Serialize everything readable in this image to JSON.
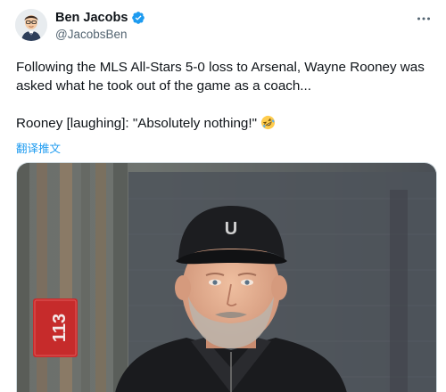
{
  "author": {
    "display_name": "Ben Jacobs",
    "handle": "@JacobsBen",
    "verified": true
  },
  "tweet": {
    "paragraph_1": "Following the MLS All-Stars 5-0 loss to Arsenal, Wayne Rooney was asked what he took out of the game as a coach...",
    "paragraph_2": "Rooney [laughing]: \"Absolutely nothing!\"",
    "emoji": "rolling-on-floor-laughing-emoji",
    "translate_label": "翻译推文"
  },
  "media": {
    "cap_logo_text": "U",
    "sign_text": "113"
  },
  "colors": {
    "link_blue": "#1d9bf0",
    "verified_blue": "#1d9bf0",
    "secondary_text": "#536471",
    "sign_red": "#c62b2b"
  },
  "icons": {
    "more": "more-horizontal-icon",
    "verified": "verified-badge-icon"
  }
}
